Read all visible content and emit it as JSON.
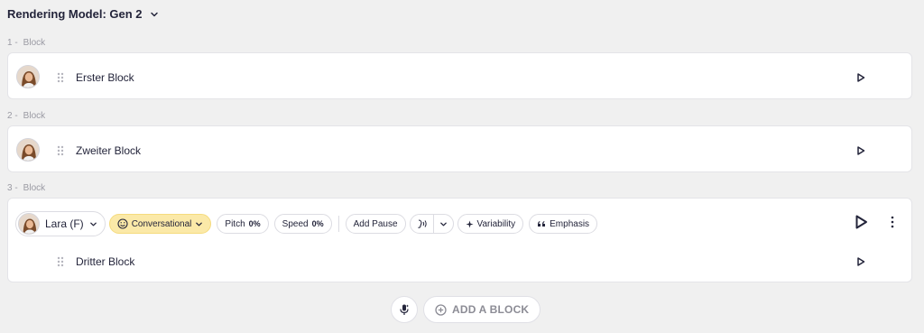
{
  "header": {
    "model_label": "Rendering Model: Gen 2"
  },
  "blocks": [
    {
      "number": "1 -",
      "label": "Block",
      "text": "Erster Block"
    },
    {
      "number": "2 -",
      "label": "Block",
      "text": "Zweiter Block"
    },
    {
      "number": "3 -",
      "label": "Block",
      "text": "Dritter Block"
    }
  ],
  "toolbar": {
    "voice_name": "Lara (F)",
    "style_label": "Conversational",
    "pitch_label": "Pitch",
    "pitch_value": "0%",
    "speed_label": "Speed",
    "speed_value": "0%",
    "add_pause_label": "Add Pause",
    "variability_label": "Variability",
    "emphasis_label": "Emphasis"
  },
  "footer": {
    "add_block_label": "ADD A BLOCK"
  },
  "colors": {
    "accent_style": "#fbe9a8",
    "text": "#23243a",
    "muted": "#9a9aa3"
  },
  "icons": [
    "chevron-down-icon",
    "drag-handle-icon",
    "play-icon",
    "smile-icon",
    "speech-icon",
    "sparkle-icon",
    "quote-icon",
    "kebab-icon",
    "mic-icon",
    "plus-circle-icon"
  ]
}
